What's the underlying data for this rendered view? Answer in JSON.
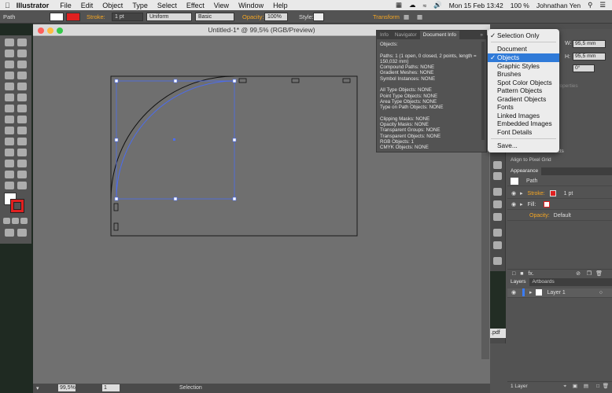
{
  "menubar": {
    "app": "Illustrator",
    "items": [
      "File",
      "Edit",
      "Object",
      "Type",
      "Select",
      "Effect",
      "View",
      "Window",
      "Help"
    ],
    "datetime": "Mon 15 Feb  13:42",
    "battery": "100 %",
    "user": "Johnathan Yen"
  },
  "control": {
    "object_type": "Path",
    "stroke_label": "Stroke:",
    "stroke_weight": "1 pt",
    "profile": "Uniform",
    "brush": "Basic",
    "opacity_label": "Opacity:",
    "opacity_value": "100%",
    "style_label": "Style:",
    "transform_label": "Transform"
  },
  "document": {
    "title": "Untitled-1* @ 99,5% (RGB/Preview)",
    "zoom": "99,5%",
    "page": "1",
    "status": "Selection"
  },
  "docinfo": {
    "tabs": [
      "Info",
      "Navigator",
      "Document Info"
    ],
    "body": "Objects:\n\nPaths: 1 (1 open, 0 closed, 2 points, length =\n150,032 mm)\nCompound Paths: NONE\nGradient Meshes: NONE\nSymbol Instances: NONE\n\nAll Type Objects: NONE\nPoint Type Objects: NONE\nArea Type Objects: NONE\nType on Path Objects: NONE\n\nClipping Masks: NONE\nOpacity Masks: NONE\nTransparent Groups: NONE\nTransparent Objects: NONE\nRGB Objects: 1\nCMYK Objects: NONE"
  },
  "dropdown": {
    "items": [
      "Selection Only",
      "Document",
      "Objects",
      "Graphic Styles",
      "Brushes",
      "Spot Color Objects",
      "Pattern Objects",
      "Gradient Objects",
      "Fonts",
      "Linked Images",
      "Embedded Images",
      "Font Details",
      "Save..."
    ]
  },
  "transform": {
    "w_label": "W:",
    "w": "95,5 mm",
    "h_label": "H:",
    "h": "95,5 mm",
    "angle": "0°"
  },
  "properties_link": "Properties",
  "align": {
    "scale_strokes": "Scale Strokes & Effects",
    "align_pixel": "Align to Pixel Grid",
    "layers_hint": "ers"
  },
  "appearance": {
    "tab": "Appearance",
    "path": "Path",
    "stroke_label": "Stroke:",
    "stroke_value": "1 pt",
    "fill_label": "Fill:",
    "opacity_label": "Opacity:",
    "opacity_value": "Default",
    "fx": "fx."
  },
  "layers": {
    "tabs": [
      "Layers",
      "Artboards"
    ],
    "layer1": "Layer 1",
    "count": "1 Layer"
  },
  "desktop": {
    "pdf_label": ".pdf"
  },
  "colors": {
    "accent": "#2f7ad8",
    "orange": "#f5a623",
    "selection": "#4b6cf0",
    "stroke_red": "#e02020"
  }
}
